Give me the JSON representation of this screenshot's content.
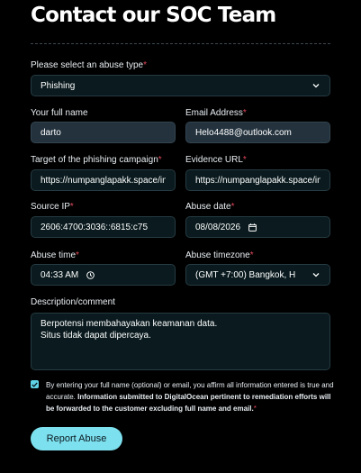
{
  "page": {
    "title": "Contact our SOC Team"
  },
  "form": {
    "abuse_type": {
      "label": "Please select an abuse type",
      "value": "Phishing"
    },
    "full_name": {
      "label": "Your full name",
      "value": "darto"
    },
    "email": {
      "label": "Email Address",
      "value": "Helo4488@outlook.com"
    },
    "target": {
      "label": "Target of the phishing campaign",
      "value": "https://numpanglapakk.space/in"
    },
    "evidence": {
      "label": "Evidence URL",
      "value": "https://numpanglapakk.space/in"
    },
    "source_ip": {
      "label": "Source IP",
      "value": "2606:4700:3036::6815:c75"
    },
    "abuse_date": {
      "label": "Abuse date",
      "value": "08/08/2026"
    },
    "abuse_time": {
      "label": "Abuse time",
      "value": "04:33 AM"
    },
    "timezone": {
      "label": "Abuse timezone",
      "value": "(GMT +7:00) Bangkok, H"
    },
    "description": {
      "label": "Description/comment",
      "line1": "Berpotensi membahayakan keamanan data.",
      "line2": "Situs tidak dapat dipercaya."
    },
    "required_marker": "*",
    "consent": {
      "checked": true,
      "text_plain": "By entering your full name (optional) or email, you affirm all information entered is true and accurate.",
      "text_bold": "Information submitted to DigitalOcean pertinent to remediation efforts will be forwarded to the customer excluding full name and email.",
      "required_marker": "*"
    },
    "submit_label": "Report Abuse"
  },
  "colors": {
    "background": "#000000",
    "accent": "#7de0ee",
    "required": "#e0485a",
    "field_bg": "#0a1a1e",
    "field_filled_bg": "#23323d"
  },
  "icons": {
    "select_chevron": "chevron-down-icon",
    "calendar": "calendar-icon",
    "clock": "clock-icon",
    "check": "check-icon"
  }
}
